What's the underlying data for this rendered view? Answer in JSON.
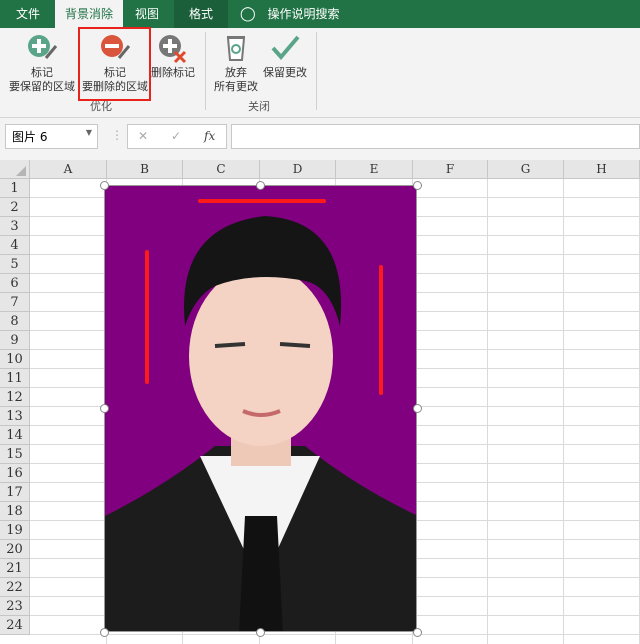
{
  "tabs": [
    {
      "label": "文件"
    },
    {
      "label": "背景消除"
    },
    {
      "label": "视图"
    },
    {
      "label": "格式"
    }
  ],
  "search": {
    "label": "操作说明搜索",
    "icon": "lightbulb-icon"
  },
  "ribbon": {
    "mark_keep": {
      "line1": "标记",
      "line2": "要保留的区域"
    },
    "mark_remove": {
      "line1": "标记",
      "line2": "要删除的区域"
    },
    "delete_mark": "删除标记",
    "group_refine": "优化",
    "discard": {
      "line1": "放弃",
      "line2": "所有更改"
    },
    "keep_changes": "保留更改",
    "group_close": "关闭"
  },
  "formula_bar": {
    "name_box": "图片 6",
    "cancel": "✕",
    "enter": "✓",
    "fx": "fx",
    "value": ""
  },
  "columns": [
    "A",
    "B",
    "C",
    "D",
    "E",
    "F",
    "G",
    "H"
  ],
  "rows": [
    "1",
    "2",
    "3",
    "4",
    "5",
    "6",
    "7",
    "8",
    "9",
    "10",
    "11",
    "12",
    "13",
    "14",
    "15",
    "16",
    "17",
    "18",
    "19",
    "20",
    "21",
    "22",
    "23",
    "24"
  ],
  "colors": {
    "accent": "#217346",
    "background_fill": "#800080",
    "mark_line": "#ff1a1a"
  }
}
